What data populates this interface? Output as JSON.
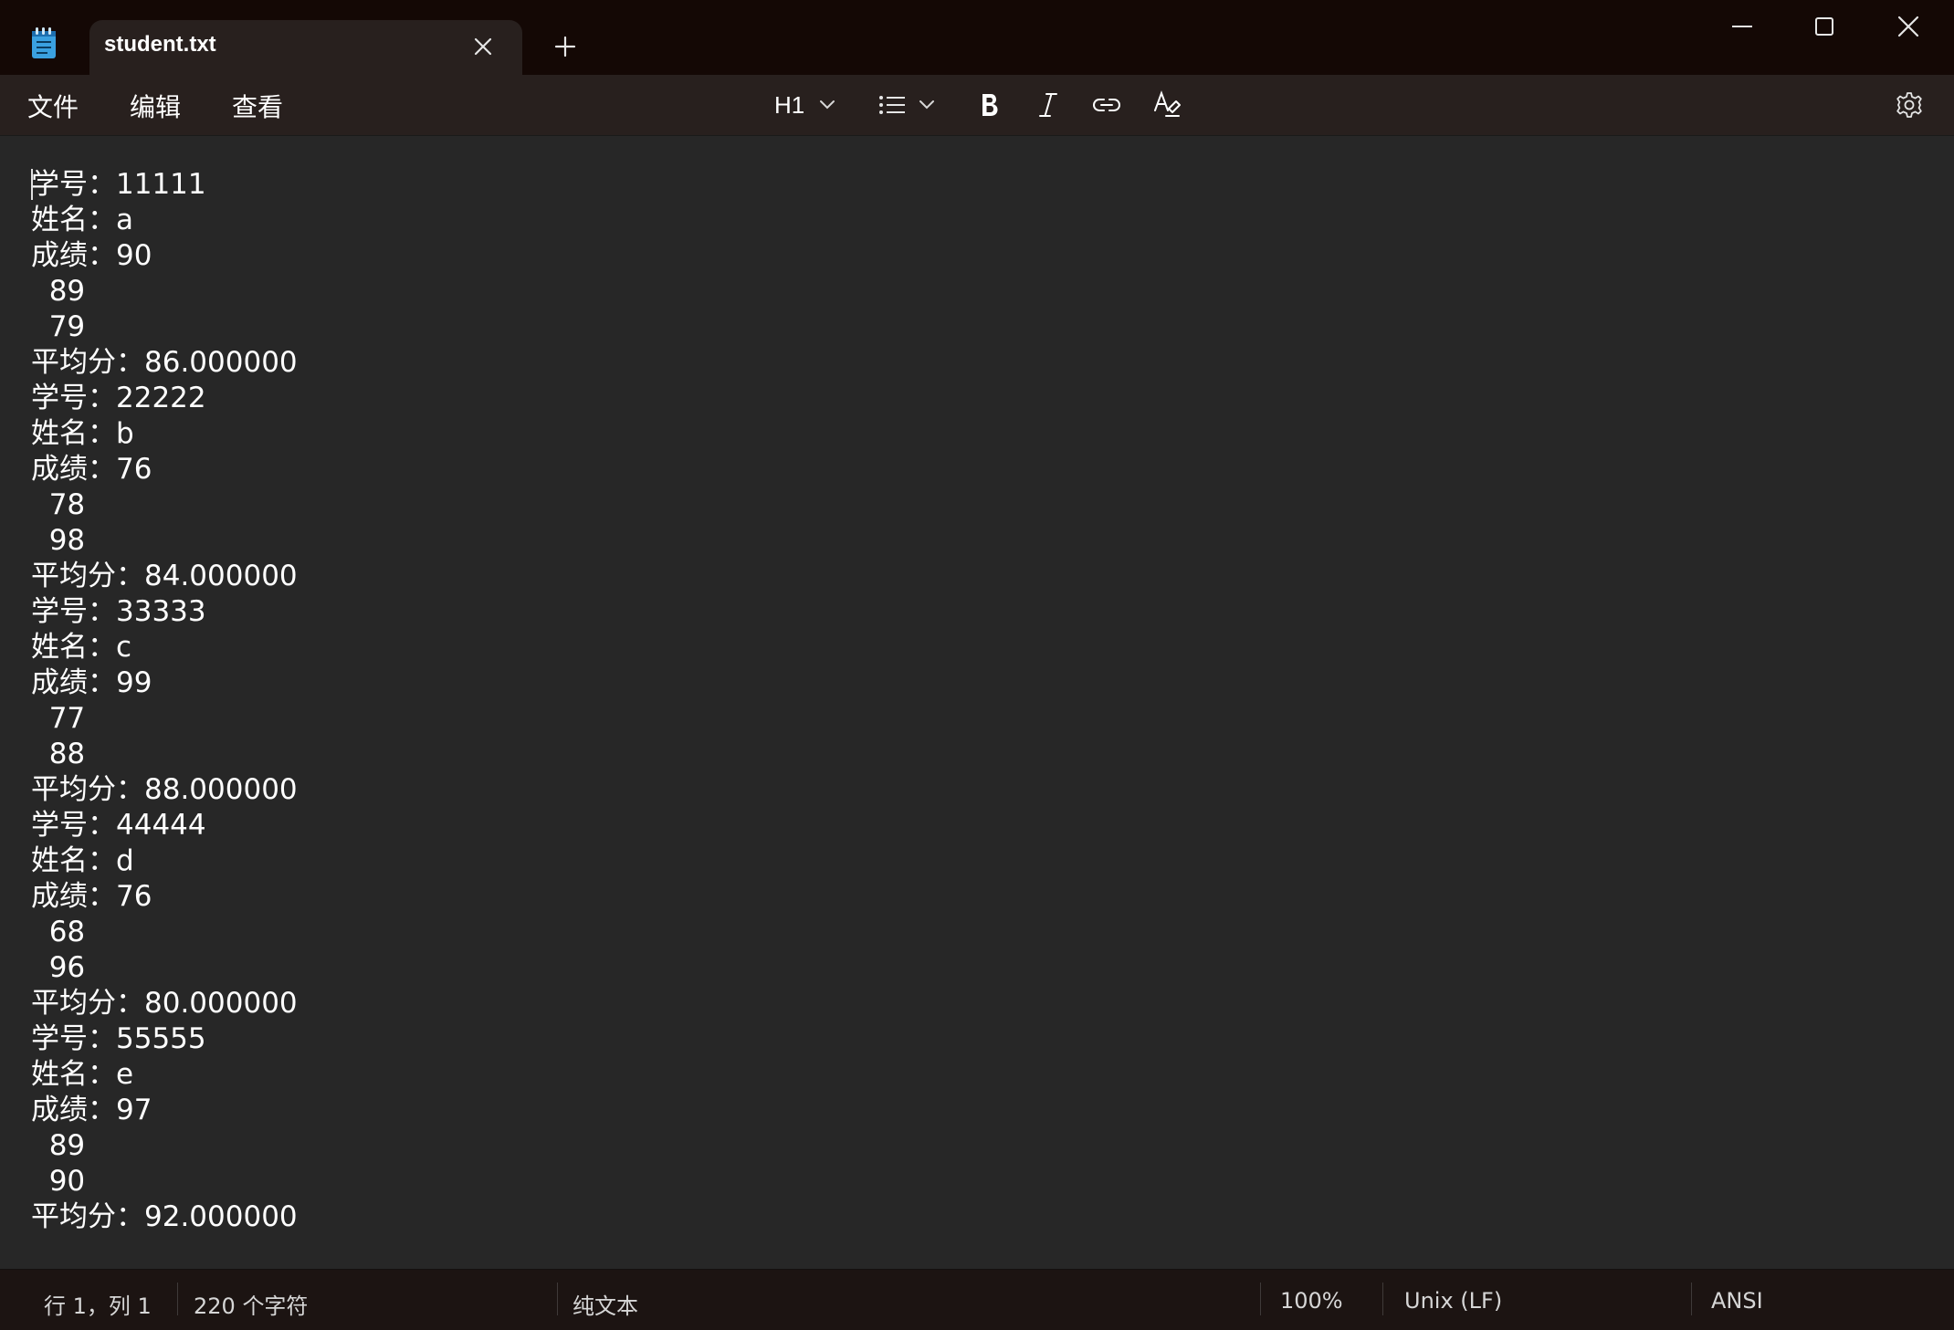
{
  "tab": {
    "title": "student.txt"
  },
  "menu": {
    "file": "文件",
    "edit": "编辑",
    "view": "查看"
  },
  "toolbar": {
    "heading": "H1"
  },
  "editor": {
    "lines": [
      "学号：11111",
      "姓名：a",
      "成绩：90",
      "  89",
      "  79",
      "平均分：86.000000",
      "学号：22222",
      "姓名：b",
      "成绩：76",
      "  78",
      "  98",
      "平均分：84.000000",
      "学号：33333",
      "姓名：c",
      "成绩：99",
      "  77",
      "  88",
      "平均分：88.000000",
      "学号：44444",
      "姓名：d",
      "成绩：76",
      "  68",
      "  96",
      "平均分：80.000000",
      "学号：55555",
      "姓名：e",
      "成绩：97",
      "  89",
      "  90",
      "平均分：92.000000"
    ]
  },
  "status": {
    "position": "行 1，列 1",
    "char_count": "220 个字符",
    "format": "纯文本",
    "zoom": "100%",
    "line_ending": "Unix (LF)",
    "encoding": "ANSI"
  },
  "icons": {
    "app": "notepad-icon",
    "tab_close": "close-icon",
    "new_tab": "plus-icon",
    "heading_dropdown": "chevron-down-icon",
    "list": "bulleted-list-icon",
    "bold": "bold-icon",
    "italic": "italic-icon",
    "link": "link-icon",
    "clear_format": "clear-formatting-icon",
    "settings": "gear-icon"
  },
  "colors": {
    "title_bar": "#140805",
    "tab_active": "#28201e",
    "editor_bg": "#272727",
    "status_bar": "#1c1412"
  }
}
